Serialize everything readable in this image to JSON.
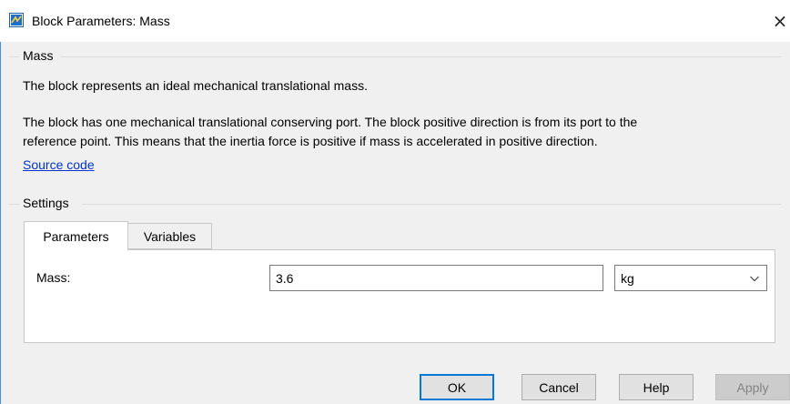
{
  "window": {
    "title": "Block Parameters: Mass",
    "close_label": "×"
  },
  "description_group": {
    "title": "Mass",
    "line1": "The block represents an ideal mechanical translational mass.",
    "line2": "The block has one mechanical translational conserving port. The block positive direction is from its port to the",
    "line3": "reference point. This means that the inertia force is positive if mass is accelerated in positive direction.",
    "link": "Source code"
  },
  "settings_group": {
    "title": "Settings",
    "tabs": [
      {
        "label": "Parameters",
        "active": true
      },
      {
        "label": "Variables",
        "active": false
      }
    ],
    "fields": [
      {
        "label": "Mass:",
        "value": "3.6",
        "unit": "kg"
      }
    ]
  },
  "buttons": {
    "ok": "OK",
    "cancel": "Cancel",
    "help": "Help",
    "apply": "Apply"
  },
  "colors": {
    "window_bg": "#f0f0f0",
    "link": "#0033cc",
    "focus_border": "#0078d7",
    "disabled_text": "#838383"
  }
}
